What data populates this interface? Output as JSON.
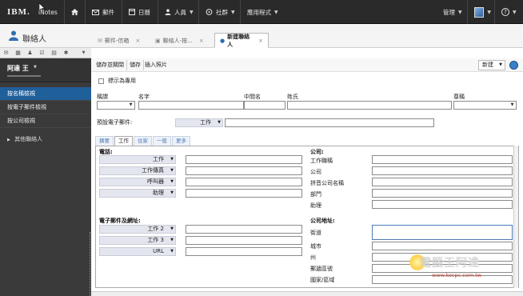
{
  "topbar": {
    "logo": "IBM.",
    "product": "iNotes",
    "nav": [
      {
        "label": "",
        "icon": "home-icon"
      },
      {
        "label": "郵件",
        "icon": "mail-icon"
      },
      {
        "label": "日曆",
        "icon": "calendar-icon"
      },
      {
        "label": "人員",
        "icon": "people-icon"
      },
      {
        "label": "社群",
        "icon": "community-icon"
      },
      {
        "label": "應用程式",
        "icon": ""
      }
    ],
    "admin": "管理",
    "help": "?"
  },
  "title": "聯絡人",
  "tabs": [
    {
      "label": "郵件-信箱",
      "active": false
    },
    {
      "label": "聯絡人-按...",
      "active": false
    },
    {
      "label": "新建聯絡人",
      "active": true
    }
  ],
  "sidebar": {
    "user_name": "阿達 王",
    "items": [
      {
        "label": "按名稱檢視",
        "selected": true
      },
      {
        "label": "按電子郵件檢視",
        "selected": false
      },
      {
        "label": "按公司檢視",
        "selected": false
      }
    ],
    "group": "其他聯絡人"
  },
  "toolbar": {
    "save_close": "儲存並關閉",
    "save": "儲存",
    "insert_image": "插入照片",
    "new": "新建"
  },
  "form": {
    "private_label": "標示為專用",
    "title_label": "稱謂",
    "first_label": "名字",
    "middle_label": "中間名",
    "last_label": "姓氏",
    "suffix_label": "尊稱",
    "default_email_label": "預設電子郵件:",
    "default_email_type": "工作"
  },
  "subtabs": [
    "摘要",
    "工作",
    "住家",
    "一般",
    "更多"
  ],
  "phone": {
    "title": "電話:",
    "rows": [
      "工作",
      "工作傳真",
      "呼叫器",
      "助理"
    ]
  },
  "email": {
    "title": "電子郵件及網址:",
    "rows": [
      "工作 2",
      "工作 3",
      "URL"
    ]
  },
  "company": {
    "title": "公司:",
    "rows": [
      "工作職稱",
      "公司",
      "拼音公司名稱",
      "部門",
      "助理"
    ]
  },
  "address": {
    "title": "公司地址:",
    "rows": [
      "街道",
      "城市",
      "州",
      "郵遞區號",
      "國家/區域"
    ]
  },
  "watermark": {
    "text": "電腦王阿達",
    "url": "www.kocpc.com.tw"
  }
}
